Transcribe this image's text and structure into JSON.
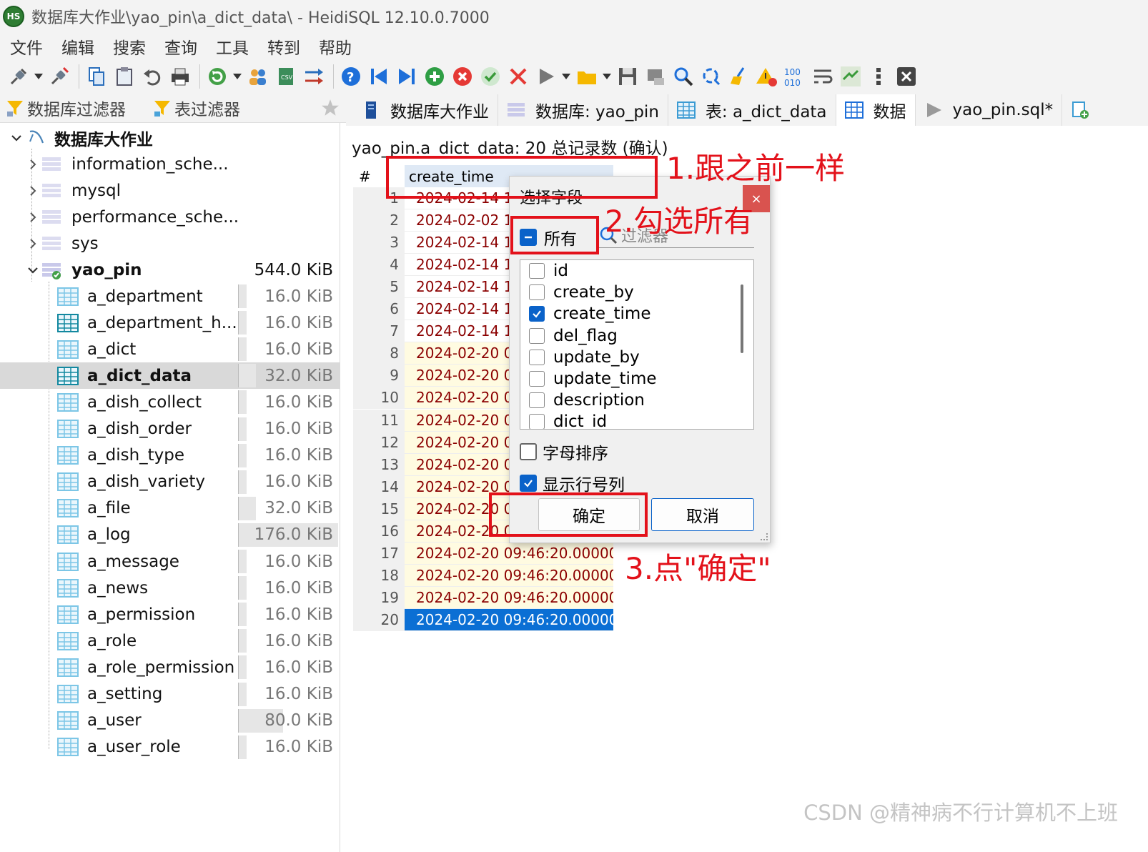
{
  "window": {
    "title": "数据库大作业\\yao_pin\\a_dict_data\\ - HeidiSQL 12.10.0.7000",
    "app_icon_text": "HS"
  },
  "menu": [
    "文件",
    "编辑",
    "搜索",
    "查询",
    "工具",
    "转到",
    "帮助"
  ],
  "filters": {
    "db_filter": "数据库过滤器",
    "table_filter": "表过滤器"
  },
  "tabs": [
    {
      "label": "数据库大作业",
      "icon": "server-icon"
    },
    {
      "label": "数据库: yao_pin",
      "icon": "database-icon"
    },
    {
      "label": "表: a_dict_data",
      "icon": "table-icon"
    },
    {
      "label": "数据",
      "icon": "grid-icon",
      "active": true
    },
    {
      "label": "yao_pin.sql*",
      "icon": "play-icon"
    }
  ],
  "tree": {
    "root": "数据库大作业",
    "databases": [
      {
        "name": "information_sche...",
        "expanded": false
      },
      {
        "name": "mysql",
        "expanded": false
      },
      {
        "name": "performance_sche...",
        "expanded": false
      },
      {
        "name": "sys",
        "expanded": false
      },
      {
        "name": "yao_pin",
        "expanded": true,
        "size": "544.0 KiB"
      }
    ],
    "tables": [
      {
        "name": "a_department",
        "size": "16.0 KiB",
        "fill": 0.03
      },
      {
        "name": "a_department_h...",
        "size": "16.0 KiB",
        "fill": 0.03
      },
      {
        "name": "a_dict",
        "size": "16.0 KiB",
        "fill": 0.03
      },
      {
        "name": "a_dict_data",
        "size": "32.0 KiB",
        "fill": 0.18,
        "selected": true
      },
      {
        "name": "a_dish_collect",
        "size": "16.0 KiB",
        "fill": 0.03
      },
      {
        "name": "a_dish_order",
        "size": "16.0 KiB",
        "fill": 0.03
      },
      {
        "name": "a_dish_type",
        "size": "16.0 KiB",
        "fill": 0.03
      },
      {
        "name": "a_dish_variety",
        "size": "16.0 KiB",
        "fill": 0.03
      },
      {
        "name": "a_file",
        "size": "32.0 KiB",
        "fill": 0.18
      },
      {
        "name": "a_log",
        "size": "176.0 KiB",
        "fill": 1.0
      },
      {
        "name": "a_message",
        "size": "16.0 KiB",
        "fill": 0.03
      },
      {
        "name": "a_news",
        "size": "16.0 KiB",
        "fill": 0.03
      },
      {
        "name": "a_permission",
        "size": "16.0 KiB",
        "fill": 0.03
      },
      {
        "name": "a_role",
        "size": "16.0 KiB",
        "fill": 0.03
      },
      {
        "name": "a_role_permission",
        "size": "16.0 KiB",
        "fill": 0.03
      },
      {
        "name": "a_setting",
        "size": "16.0 KiB",
        "fill": 0.03
      },
      {
        "name": "a_user",
        "size": "80.0 KiB",
        "fill": 0.45
      },
      {
        "name": "a_user_role",
        "size": "16.0 KiB",
        "fill": 0.03
      }
    ]
  },
  "grid": {
    "heading": "yao_pin.a_dict_data: 20 总记录数 (确认)",
    "row_number_header": "#",
    "column_header": "create_time",
    "rows": [
      {
        "n": "1",
        "value": "2024-02-14 15"
      },
      {
        "n": "2",
        "value": "2024-02-02 15"
      },
      {
        "n": "3",
        "value": "2024-02-14 15"
      },
      {
        "n": "4",
        "value": "2024-02-14 15"
      },
      {
        "n": "5",
        "value": "2024-02-14 15"
      },
      {
        "n": "6",
        "value": "2024-02-14 15"
      },
      {
        "n": "7",
        "value": "2024-02-14 15"
      },
      {
        "n": "8",
        "value": "2024-02-20 09"
      },
      {
        "n": "9",
        "value": "2024-02-20 09"
      },
      {
        "n": "10",
        "value": "2024-02-20 09"
      },
      {
        "n": "11",
        "value": "2024-02-20 09"
      },
      {
        "n": "12",
        "value": "2024-02-20 09"
      },
      {
        "n": "13",
        "value": "2024-02-20 09"
      },
      {
        "n": "14",
        "value": "2024-02-20 09"
      },
      {
        "n": "15",
        "value": "2024-02-20 09"
      },
      {
        "n": "16",
        "value": "2024-02-20 09"
      },
      {
        "n": "17",
        "value": "2024-02-20 09:46:20.000000"
      },
      {
        "n": "18",
        "value": "2024-02-20 09:46:20.000000"
      },
      {
        "n": "19",
        "value": "2024-02-20 09:46:20.000000"
      },
      {
        "n": "20",
        "value": "2024-02-20 09:46:20.000000"
      }
    ]
  },
  "dialog": {
    "title": "选择字段",
    "close": "×",
    "all_label": "所有",
    "filter_placeholder": "过滤器",
    "fields": [
      {
        "name": "id",
        "checked": false
      },
      {
        "name": "create_by",
        "checked": false
      },
      {
        "name": "create_time",
        "checked": true
      },
      {
        "name": "del_flag",
        "checked": false
      },
      {
        "name": "update_by",
        "checked": false
      },
      {
        "name": "update_time",
        "checked": false
      },
      {
        "name": "description",
        "checked": false
      },
      {
        "name": "dict_id",
        "checked": false
      }
    ],
    "sort_alpha_label": "字母排序",
    "sort_alpha_checked": false,
    "show_rownum_label": "显示行号列",
    "show_rownum_checked": true,
    "ok_label": "确定",
    "cancel_label": "取消"
  },
  "annotations": {
    "step1": "1.跟之前一样",
    "step2": "2.勾选所有",
    "step3": "3.点\"确定\"",
    "color": "#e3111a"
  },
  "watermark": "CSDN @精神病不行计算机不上班",
  "colors": {
    "selection": "#0b6fd4",
    "alt_row": "#fffbe1",
    "value_text": "#8b0000"
  }
}
